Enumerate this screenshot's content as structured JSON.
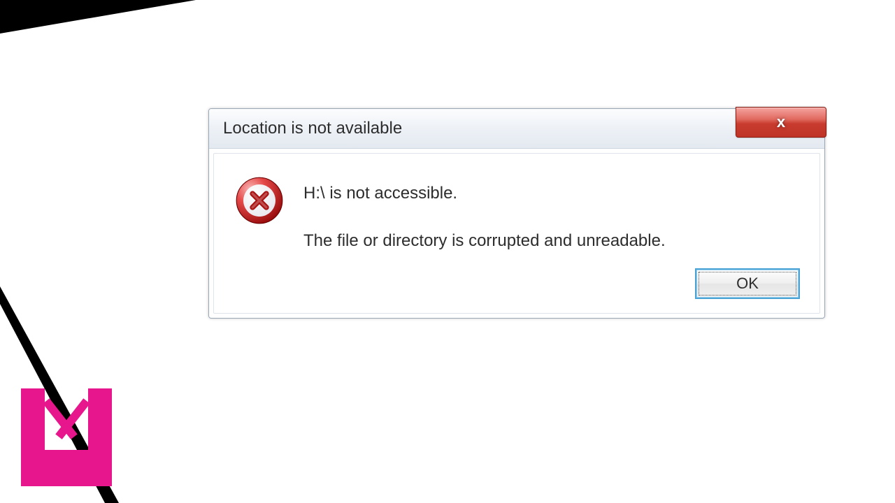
{
  "dialog": {
    "title": "Location is not available",
    "close_glyph": "x",
    "message_line1": "H:\\ is not accessible.",
    "message_line2": "The file or directory is corrupted and unreadable.",
    "ok_label": "OK"
  },
  "icons": {
    "error": "error-cross-circle"
  },
  "colors": {
    "brand_pink": "#e8168c",
    "close_red": "#c83b2e",
    "focus_blue": "#4aa3d4"
  }
}
